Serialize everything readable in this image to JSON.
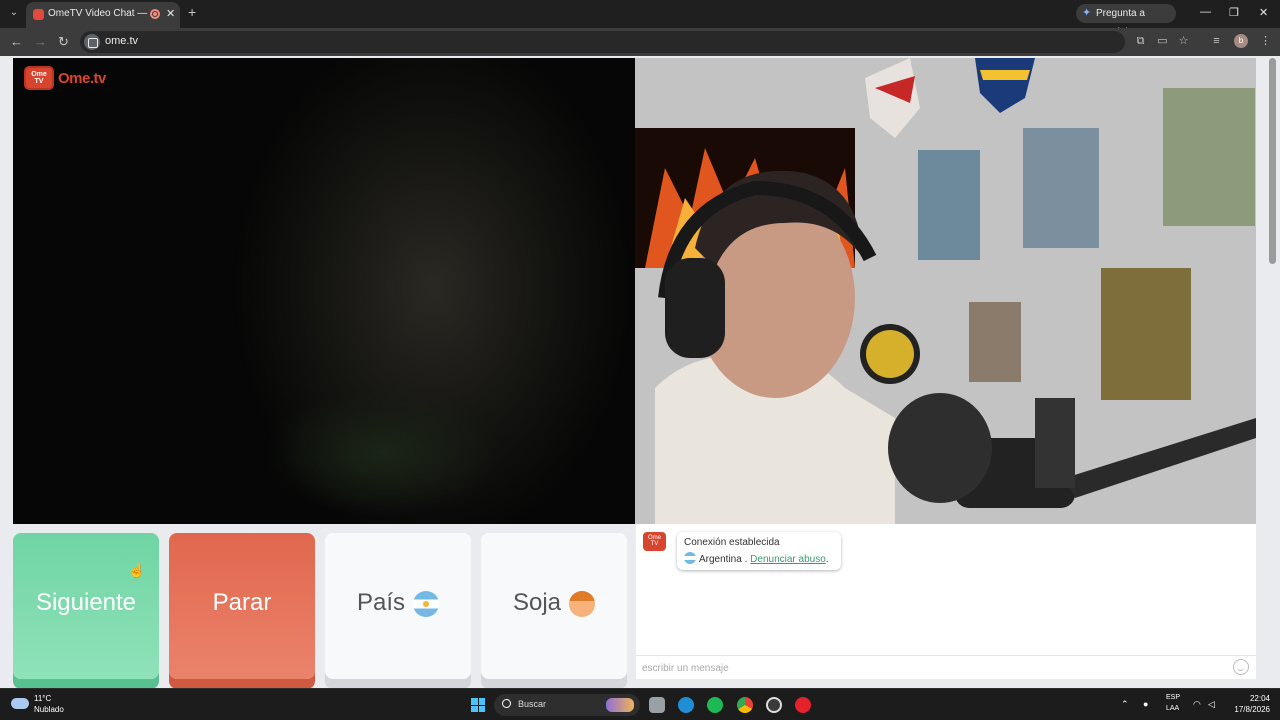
{
  "browser": {
    "tab_title": "OmeTV Video Chat — Alte",
    "tab_close": "✕",
    "new_tab": "+",
    "gemini_label": "Pregunta a Gemini",
    "url": "ome.tv",
    "profile_initial": "b",
    "window_controls": [
      "—",
      "❐",
      "✕"
    ]
  },
  "page": {
    "logo_badge": "Ome TV",
    "logo_text": "Ome.tv",
    "buttons": {
      "next": "Siguiente",
      "stop": "Parar",
      "country": "País",
      "gender": "Soja"
    },
    "chat": {
      "status": "Conexión establecida",
      "country": "Argentina",
      "separator": " . ",
      "report_link": "Denunciar abuso",
      "period": ".",
      "input_placeholder": "escribir un mensaje"
    }
  },
  "taskbar": {
    "temperature": "11°C",
    "weather": "Nublado",
    "search_label": "Buscar",
    "lang_line1": "ESP",
    "lang_line2": "LAA",
    "time": "22:04",
    "date": "17/8/2026"
  },
  "colors": {
    "next_button": "#6fd4a3",
    "stop_button": "#e0674d",
    "brand_red": "#d9442f",
    "link_green": "#3a9b6f"
  }
}
